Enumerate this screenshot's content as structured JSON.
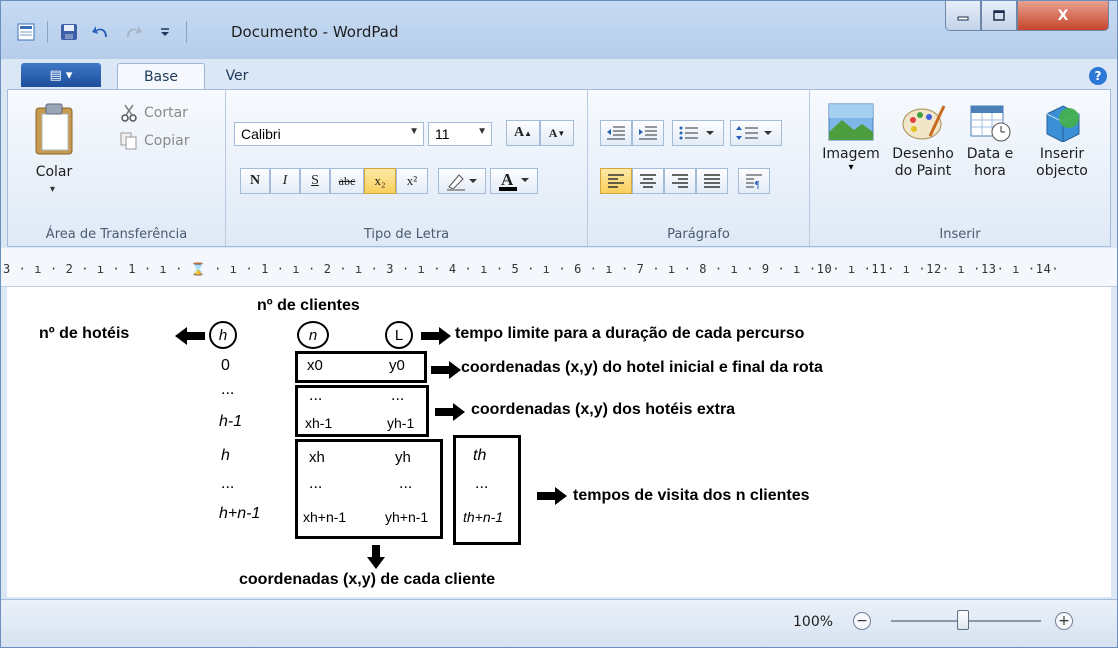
{
  "window": {
    "title": "Documento - WordPad",
    "minimize_label": "▭",
    "maximize_label": "▣",
    "close_label": "X"
  },
  "ribbon": {
    "file_menu_label": "▤ ▾",
    "tabs": [
      {
        "label": "Base"
      },
      {
        "label": "Ver"
      }
    ],
    "help_label": "?",
    "clipboard": {
      "paste_label": "Colar",
      "cut_label": "Cortar",
      "copy_label": "Copiar",
      "group_label": "Área de Transferência"
    },
    "font": {
      "family": "Calibri",
      "size": "11",
      "bold": "N",
      "italic": "I",
      "underline": "S",
      "strike": "abc",
      "subscript": "x₂",
      "superscript": "x²",
      "grow": "A",
      "shrink": "A",
      "group_label": "Tipo de Letra"
    },
    "paragraph": {
      "group_label": "Parágrafo"
    },
    "insert": {
      "image_label": "Imagem",
      "paint_label_1": "Desenho",
      "paint_label_2": "do Paint",
      "datetime_label_1": "Data e",
      "datetime_label_2": "hora",
      "object_label_1": "Inserir",
      "object_label_2": "objecto",
      "group_label": "Inserir"
    }
  },
  "ruler": {
    "text": "3 · ı · 2 · ı · 1 · ı · ⌛ · ı · 1 · ı · 2 · ı · 3 · ı · 4 · ı · 5 · ı · 6 · ı · 7 · ı · 8 · ı · 9 · ı ·10· ı ·11· ı ·12· ı ·13· ı ·14·"
  },
  "document": {
    "n_clients_title": "nº de clientes",
    "n_hotels": "nº de hotéis",
    "circle_h": "h",
    "circle_n": "n",
    "circle_L": "L",
    "time_limit": "tempo limite para a duração de cada percurso",
    "row_0": "0",
    "x0": "x0",
    "y0": "y0",
    "coords_start_end": "coordenadas (x,y) do hotel inicial e final da rota",
    "dots_1": "...",
    "dots_2": "...",
    "dots_3": "...",
    "row_h_minus_1": "h-1",
    "x_h_minus_1": "xh-1",
    "y_h_minus_1": "yh-1",
    "coords_extra": "coordenadas (x,y) dos hotéis extra",
    "row_h": "h",
    "x_h": "xh",
    "y_h": "yh",
    "t_h": "th",
    "dots_4": "...",
    "dots_5": "...",
    "dots_6": "...",
    "dots_7": "...",
    "visit_times": "tempos de visita dos n clientes",
    "row_h_plus_n_minus_1": "h+n-1",
    "x_h_plus_n_minus_1": "xh+n-1",
    "y_h_plus_n_minus_1": "yh+n-1",
    "t_h_plus_n_minus_1": "th+n-1",
    "coords_clients": "coordenadas (x,y) de cada cliente"
  },
  "status": {
    "zoom": "100%",
    "zoom_out": "−",
    "zoom_in": "+"
  }
}
